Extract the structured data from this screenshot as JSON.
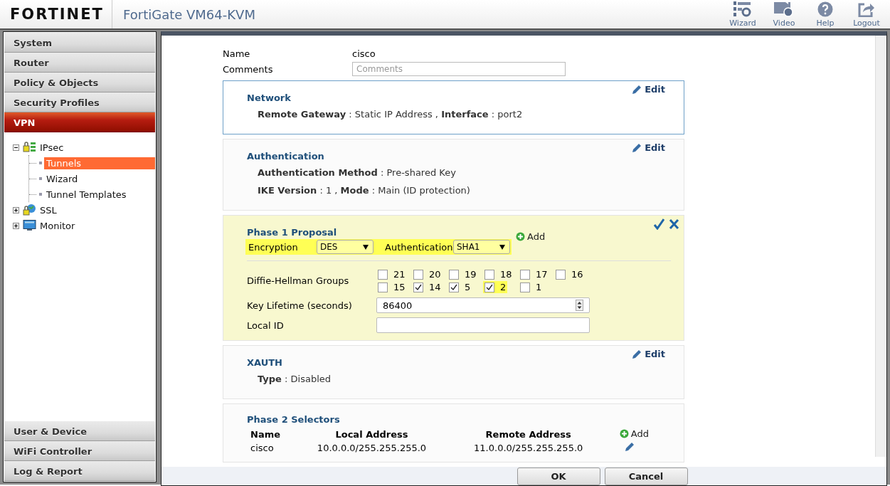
{
  "header": {
    "logo": "FORTINET",
    "title": "FortiGate VM64-KVM",
    "tools": [
      {
        "kind": "wizard",
        "label": "Wizard"
      },
      {
        "kind": "video",
        "label": "Video"
      },
      {
        "kind": "help",
        "label": "Help"
      },
      {
        "kind": "logout",
        "label": "Logout"
      }
    ]
  },
  "sidebar": {
    "menus_top": [
      {
        "label": "System",
        "selected": false
      },
      {
        "label": "Router",
        "selected": false
      },
      {
        "label": "Policy & Objects",
        "selected": false
      },
      {
        "label": "Security Profiles",
        "selected": false
      },
      {
        "label": "VPN",
        "selected": true
      }
    ],
    "tree": [
      {
        "label": "IPsec",
        "kind": "ipsec",
        "expanded": true,
        "children": [
          {
            "label": "Tunnels",
            "selected": true
          },
          {
            "label": "Wizard",
            "selected": false
          },
          {
            "label": "Tunnel Templates",
            "selected": false
          }
        ]
      },
      {
        "label": "SSL",
        "kind": "ssl",
        "expanded": false
      },
      {
        "label": "Monitor",
        "kind": "monitor",
        "expanded": false
      }
    ],
    "menus_bottom": [
      {
        "label": "User & Device",
        "selected": false
      },
      {
        "label": "WiFi Controller",
        "selected": false
      },
      {
        "label": "Log & Report",
        "selected": false
      }
    ]
  },
  "form": {
    "name_label": "Name",
    "name_value": "cisco",
    "comments_label": "Comments",
    "comments_placeholder": "Comments"
  },
  "sections": [
    {
      "kind": "summary",
      "title": "Network",
      "edit_label": "Edit",
      "focused": true,
      "lines": [
        "**Remote Gateway** : Static IP Address , **Interface** : port2"
      ]
    },
    {
      "kind": "summary",
      "title": "Authentication",
      "edit_label": "Edit",
      "focused": false,
      "lines": [
        "**Authentication Method** : Pre-shared Key",
        "**IKE Version** : 1 , **Mode** : Main (ID protection)"
      ]
    },
    {
      "kind": "proposal",
      "title": "Phase 1 Proposal",
      "add_label": "Add",
      "encryption": {
        "label": "Encryption",
        "value": "DES"
      },
      "authentication": {
        "label": "Authentication",
        "value": "SHA1"
      },
      "highlighted": true,
      "dh": {
        "label": "Diffie-Hellman Groups",
        "groups": [
          {
            "label": "21",
            "checked": false,
            "highlighted": false
          },
          {
            "label": "20",
            "checked": false,
            "highlighted": false
          },
          {
            "label": "19",
            "checked": false,
            "highlighted": false
          },
          {
            "label": "18",
            "checked": false,
            "highlighted": false
          },
          {
            "label": "17",
            "checked": false,
            "highlighted": false
          },
          {
            "label": "16",
            "checked": false,
            "highlighted": false
          },
          {
            "label": "15",
            "checked": false,
            "highlighted": false
          },
          {
            "label": "14",
            "checked": true,
            "highlighted": false
          },
          {
            "label": "5",
            "checked": true,
            "highlighted": false
          },
          {
            "label": "2",
            "checked": true,
            "highlighted": true
          },
          {
            "label": "1",
            "checked": false,
            "highlighted": false
          }
        ]
      },
      "key_lifetime": {
        "label": "Key Lifetime (seconds)",
        "value": "86400"
      },
      "local_id": {
        "label": "Local ID"
      }
    },
    {
      "kind": "summary",
      "title": "XAUTH",
      "edit_label": "Edit",
      "focused": false,
      "lines": [
        "**Type** : Disabled"
      ]
    },
    {
      "kind": "selectors",
      "title": "Phase 2 Selectors",
      "add_label": "Add",
      "columns": [
        "Name",
        "Local Address",
        "Remote Address"
      ],
      "rows": [
        {
          "cells": [
            "cisco",
            "10.0.0.0/255.255.255.0",
            "11.0.0.0/255.255.255.0"
          ]
        }
      ]
    }
  ],
  "buttons": [
    "OK",
    "Cancel"
  ]
}
